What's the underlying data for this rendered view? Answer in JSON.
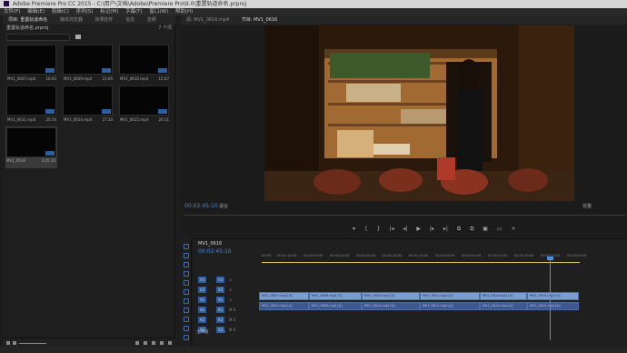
{
  "window": {
    "title": "Adobe Premiere Pro CC 2015 - C:\\用户\\文档\\Adobe\\Premiere Pro\\9.0\\重置轨道命名.prproj"
  },
  "menu": [
    "文件(F)",
    "编辑(E)",
    "剪辑(C)",
    "序列(S)",
    "标记(M)",
    "字幕(T)",
    "窗口(W)",
    "帮助(H)"
  ],
  "project_panel": {
    "tabs": [
      "项目: 重置轨道命名",
      "媒体浏览器",
      "效果控件",
      "信息",
      "音频"
    ],
    "project_name": "重置轨道命名.prproj",
    "item_count": "7 个项",
    "clips": [
      {
        "name": "MV1_0607.mp4",
        "duration": "16:03"
      },
      {
        "name": "MV1_0609.mp4",
        "duration": "21:00"
      },
      {
        "name": "MV1_0610.mp4",
        "duration": "15:07"
      },
      {
        "name": "MV1_0611.mp4",
        "duration": "25:10"
      },
      {
        "name": "MV1_0614.mp4",
        "duration": "27:10"
      },
      {
        "name": "MV1_0615.mp4",
        "duration": "20:11"
      },
      {
        "name": "MV1_0616",
        "duration": "3:05:10"
      }
    ]
  },
  "monitor": {
    "tabs": [
      "源: MV1_0616.mp4",
      "节目: MV1_0616"
    ],
    "timecode": "00:02:45:10",
    "fit": "适合",
    "quality": "完整",
    "transport": [
      "▾",
      "{",
      "}",
      "|◂",
      "◂|",
      "▶",
      "|▸",
      "▸|",
      "⧉",
      "⧉",
      "▣",
      "▭",
      "+"
    ]
  },
  "timeline": {
    "tab": "MV1_0616",
    "timecode": "00:02:45:10",
    "ruler": [
      "00:00",
      "00:00:15:00",
      "00:00:30:00",
      "00:00:45:00",
      "00:01:00:00",
      "00:01:15:00",
      "00:01:30:00",
      "00:01:45:00",
      "00:02:00:00",
      "00:02:15:00",
      "00:02:30:00",
      "00:02:45:00",
      "00:03:00:00"
    ],
    "tracks": [
      {
        "target": "V3",
        "name": "V3"
      },
      {
        "target": "V2",
        "name": "V2"
      },
      {
        "target": "V1",
        "name": "V1"
      },
      {
        "target": "A1",
        "name": "A1"
      },
      {
        "target": "A2",
        "name": "A2"
      },
      {
        "target": "A3",
        "name": "A3"
      }
    ],
    "video_clips": [
      "MV1_0607.mp4 [V]",
      "MV1_0609.mp4 [V]",
      "MV1_0610.mp4 [V]",
      "MV1_0611.mp4 [V]",
      "MV1_0614.mp4 [V]",
      "MV1_0615.mp4 [V]"
    ],
    "audio_clips": [
      "MV1_0607.mp4 [A]",
      "MV1_0609.mp4 [A]",
      "MV1_0610.mp4 [A]",
      "MV1_0611.mp4 [A]",
      "MV1_0614.mp4 [A]",
      "MV1_0615.mp4 [A]"
    ],
    "master_label": "主声道",
    "master_value": "0.0"
  }
}
